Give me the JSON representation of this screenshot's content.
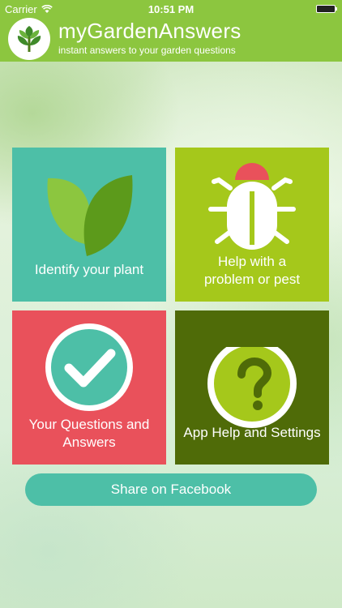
{
  "status_bar": {
    "carrier": "Carrier",
    "time": "10:51 PM"
  },
  "header": {
    "title": "myGardenAnswers",
    "subtitle": "instant answers to your garden questions",
    "logo_icon": "plant-logo-icon"
  },
  "tiles": [
    {
      "id": "identify",
      "label": "Identify your plant",
      "icon": "leaf-icon",
      "color": "#4dbfa7"
    },
    {
      "id": "problem",
      "label_line1": "Help with a",
      "label_line2": "problem or pest",
      "icon": "bug-icon",
      "color": "#a5c81b"
    },
    {
      "id": "questions",
      "label_line1": "Your Questions and",
      "label_line2": "Answers",
      "icon": "checkmark-icon",
      "color": "#e9515b"
    },
    {
      "id": "help",
      "label": "App Help and Settings",
      "icon": "question-icon",
      "color": "#4f6b08"
    }
  ],
  "share_button": {
    "label": "Share on Facebook",
    "color": "#4dbfa7"
  }
}
